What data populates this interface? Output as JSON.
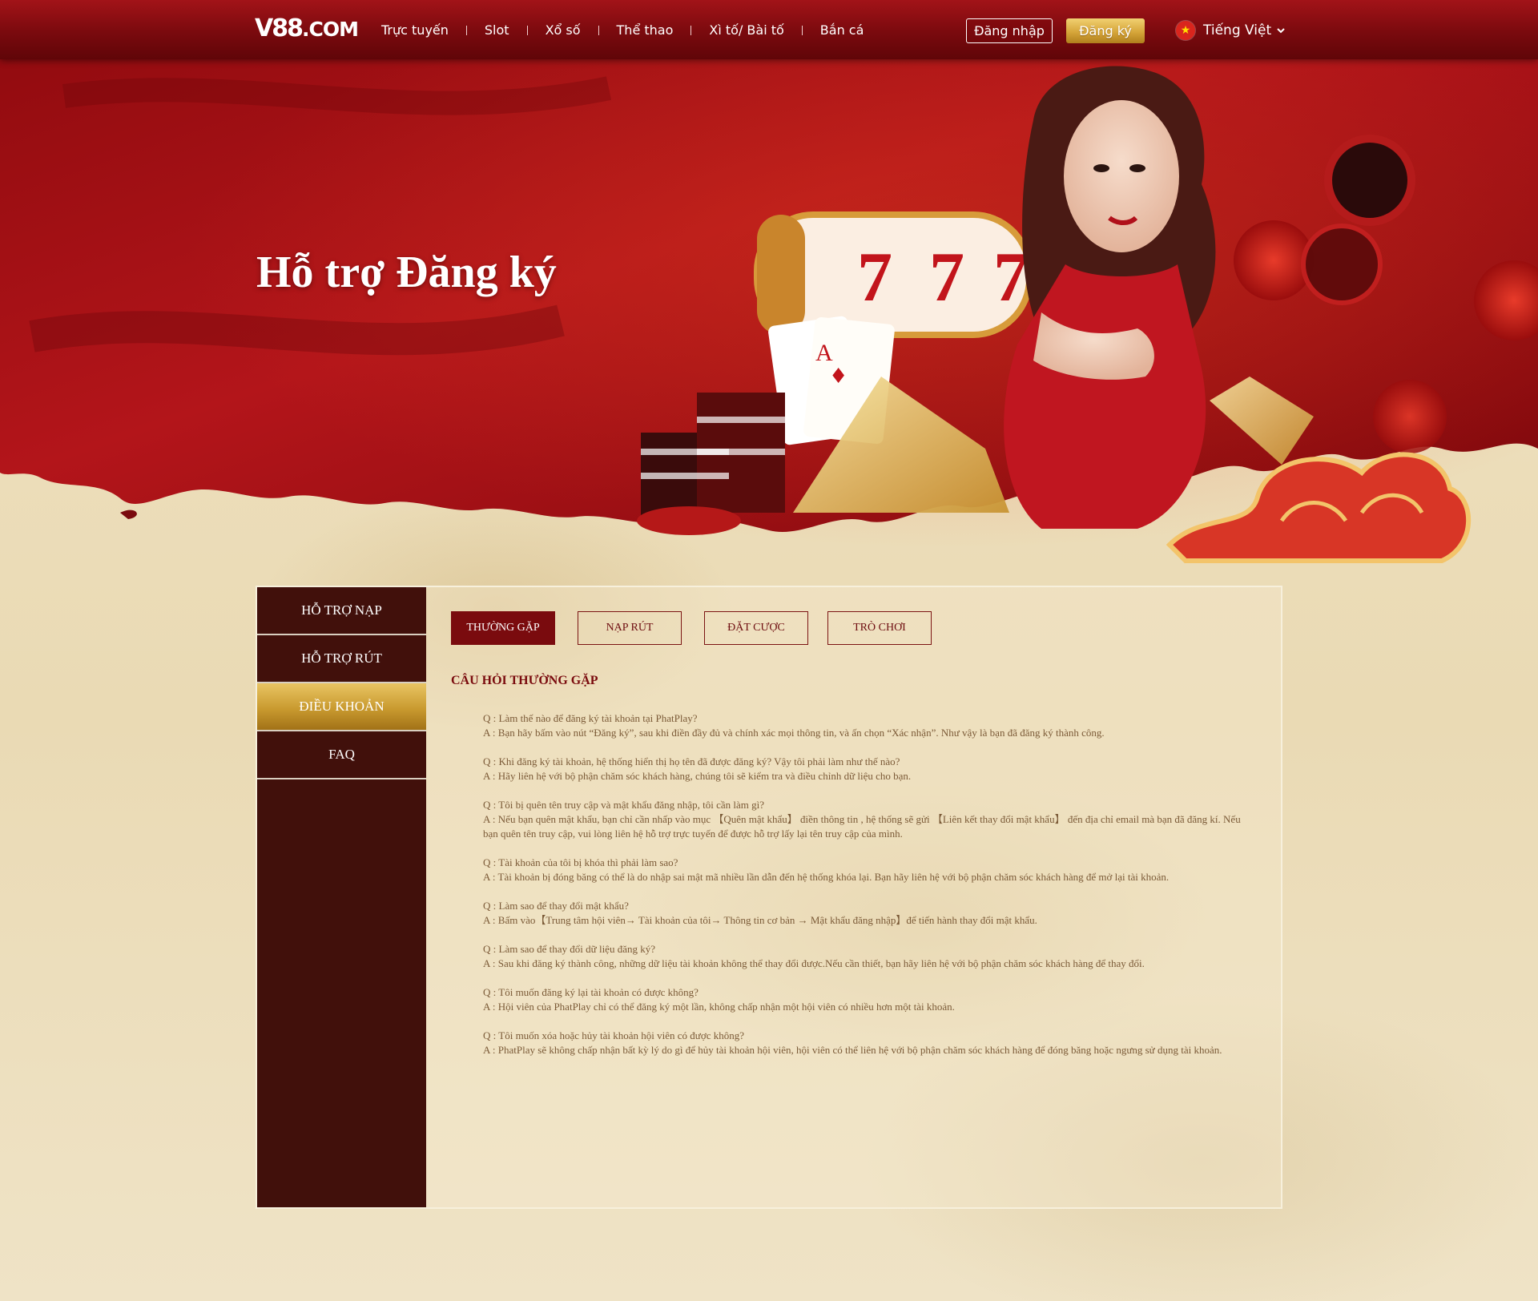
{
  "header": {
    "logo_text": "V88",
    "logo_domain": ".COM",
    "nav": [
      "Trực tuyến",
      "Slot",
      "Xổ số",
      "Thể thao",
      "Xì tố/ Bài tố",
      "Bắn cá"
    ],
    "login_label": "Đăng nhập",
    "register_label": "Đăng ký",
    "language_label": "Tiếng Việt"
  },
  "hero": {
    "title": "Hỗ trợ Đăng ký"
  },
  "sidebar": {
    "items": [
      "HỖ TRỢ NẠP",
      "HỖ TRỢ RÚT",
      "ĐIỀU KHOẢN",
      "FAQ"
    ],
    "active_index": 2
  },
  "tabs": {
    "items": [
      "THƯỜNG GẶP",
      "NẠP RÚT",
      "ĐẶT CƯỢC",
      "TRÒ CHƠI"
    ],
    "active_index": 0
  },
  "faq": {
    "title": "CÂU HỎI THƯỜNG GẶP",
    "items": [
      {
        "q": "Q : Làm thế nào để đăng ký tài khoản tại PhatPlay?",
        "a": "A : Bạn hãy bấm vào nút “Đăng ký”, sau khi điền đầy đủ và chính xác mọi thông tin, và ấn chọn “Xác nhận”. Như vậy là bạn đã đăng ký thành công."
      },
      {
        "q": "Q : Khi đăng ký tài khoản, hệ thống hiển thị họ tên đã được đăng ký? Vậy tôi phải làm như thế nào?",
        "a": "A : Hãy liên hệ với bộ phận chăm sóc khách hàng, chúng tôi sẽ kiểm tra và điều chỉnh dữ liệu cho bạn."
      },
      {
        "q": "Q : Tôi bị quên tên truy cập và mật khẩu đăng nhập, tôi cần làm gì?",
        "a": "A : Nếu bạn quên mật khẩu, bạn chỉ cần nhấp vào mục 【Quên mật khẩu】 điền thông tin , hệ thống sẽ gửi 【Liên kết thay đổi mật khẩu】 đến địa chỉ email mà bạn đã đăng kí. Nếu bạn quên tên truy cập, vui lòng liên hệ hỗ trợ trực tuyến để được hỗ trợ lấy lại tên truy cập của mình."
      },
      {
        "q": "Q : Tài khoản của tôi bị khóa thì phải làm sao?",
        "a": "A : Tài khoản bị đóng băng có thể là do nhập sai mật mã nhiều lần dẫn đến hệ thống khóa lại. Bạn hãy liên hệ với bộ phận chăm sóc khách hàng để mở lại tài khoản."
      },
      {
        "q": "Q : Làm sao để thay đổi mật khẩu?",
        "a": "A : Bấm vào【Trung tâm hội viên→ Tài khoản của tôi→ Thông tin cơ bản → Mật khẩu đăng nhập】để tiến hành thay đổi mật khẩu."
      },
      {
        "q": "Q : Làm sao để thay đổi dữ liệu đăng ký?",
        "a": "A : Sau khi đăng ký thành công, những dữ liệu tài khoản không thể thay đổi được.Nếu cần thiết, bạn hãy liên hệ với bộ phận chăm sóc khách hàng để thay đổi."
      },
      {
        "q": "Q : Tôi muốn đăng ký lại tài khoản có được không?",
        "a": "A : Hội viên của PhatPlay chỉ có thể đăng ký một lần, không chấp nhận một hội viên có nhiều hơn một tài khoản."
      },
      {
        "q": "Q : Tôi muốn xóa hoặc hủy tài khoản hội viên có được không?",
        "a": "A : PhatPlay sẽ không chấp nhận bất kỳ lý do gì để hủy tài khoản hội viên, hội viên có thể liên hệ với bộ phận chăm sóc khách hàng để đóng băng hoặc ngưng sử dụng tài khoản."
      }
    ]
  },
  "colors": {
    "brand_red": "#7a0b0e",
    "sidebar_bg": "#41100b",
    "gold": "#d6a63a",
    "faq_text": "#7b5a37"
  },
  "icons": [
    "flag-icon",
    "chevron-down-icon"
  ]
}
